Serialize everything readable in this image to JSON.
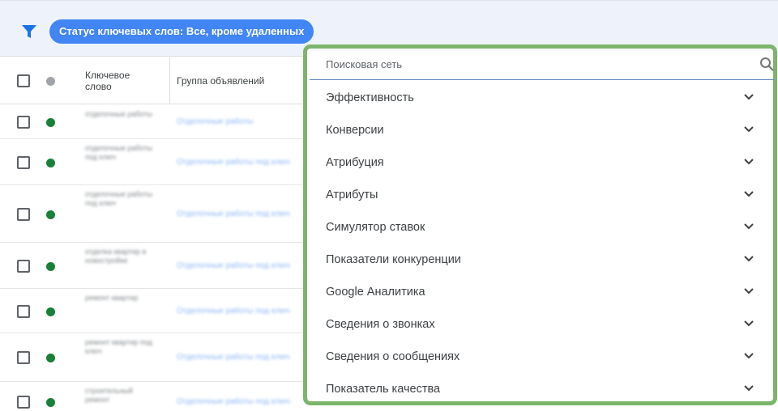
{
  "filter_bar": {
    "chip_label": "Статус ключевых слов: Все, кроме удаленных",
    "icon": "filter-icon",
    "accent_color": "#4285f4"
  },
  "table": {
    "headers": {
      "keyword": "Ключевое слово",
      "ad_group": "Группа объявлений"
    },
    "rows": [
      {
        "status": "enabled",
        "keyword": "отделочные работы",
        "ad_group": "Отделочные работы"
      },
      {
        "status": "enabled",
        "keyword": "отделочные работы под ключ",
        "ad_group": "Отделочные работы под ключ"
      },
      {
        "status": "enabled",
        "keyword": "отделочные работы под ключ",
        "ad_group": "Отделочные работы под ключ"
      },
      {
        "status": "enabled",
        "keyword": "отделка квартир в новостройке",
        "ad_group": "Отделочные работы под ключ"
      },
      {
        "status": "enabled",
        "keyword": "ремонт квартир",
        "ad_group": "Отделочные работы под ключ"
      },
      {
        "status": "enabled",
        "keyword": "ремонт квартир под ключ",
        "ad_group": "Отделочные работы под ключ"
      },
      {
        "status": "enabled",
        "keyword": "строительный ремонт",
        "ad_group": "Отделочные работы под ключ"
      }
    ],
    "status_color_enabled": "#188038"
  },
  "dropdown": {
    "search_placeholder": "Поисковая сеть",
    "search_value": "",
    "groups": [
      {
        "label": "Эффективность"
      },
      {
        "label": "Конверсии"
      },
      {
        "label": "Атрибуция"
      },
      {
        "label": "Атрибуты"
      },
      {
        "label": "Симулятор ставок"
      },
      {
        "label": "Показатели конкуренции"
      },
      {
        "label": "Google Аналитика"
      },
      {
        "label": "Сведения о звонках"
      },
      {
        "label": "Сведения о сообщениях"
      },
      {
        "label": "Показатель качества"
      }
    ],
    "highlight_color": "#7cb56b"
  }
}
